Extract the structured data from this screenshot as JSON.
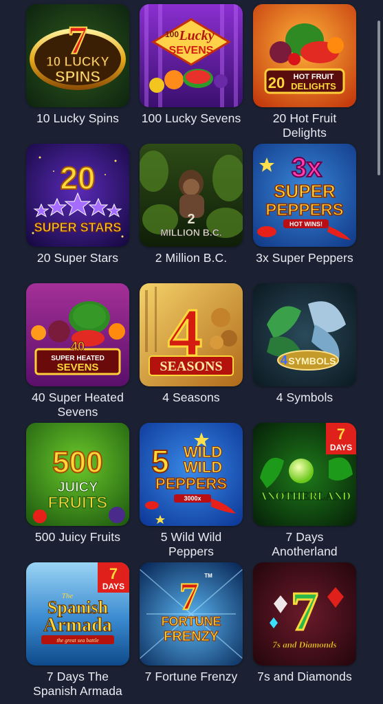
{
  "games": [
    {
      "title": "10 Lucky Spins",
      "logo": [
        "7",
        "10 LUCKY",
        "SPINS"
      ]
    },
    {
      "title": "100 Lucky Sevens",
      "logo": [
        "100",
        "Lucky",
        "SEVENS"
      ]
    },
    {
      "title": "20 Hot Fruit Delights",
      "logo": [
        "20",
        "HOT FRUIT",
        "DELIGHTS"
      ]
    },
    {
      "title": "20 Super Stars",
      "logo": [
        "20",
        "SUPER STARS"
      ]
    },
    {
      "title": "2 Million B.C.",
      "logo": [
        "2",
        "MILLION B.C."
      ]
    },
    {
      "title": "3x Super Peppers",
      "logo": [
        "3x",
        "SUPER",
        "PEPPERS",
        "HOT WINS!"
      ]
    },
    {
      "title": "40 Super Heated Sevens",
      "logo": [
        "40",
        "SUPER HEATED",
        "SEVENS"
      ]
    },
    {
      "title": "4 Seasons",
      "logo": [
        "4",
        "SEASONS"
      ]
    },
    {
      "title": "4 Symbols",
      "logo": [
        "4",
        "SYMBOLS"
      ]
    },
    {
      "title": "500 Juicy Fruits",
      "logo": [
        "500",
        "JUICY",
        "FRUITS"
      ]
    },
    {
      "title": "5 Wild Wild Peppers",
      "logo": [
        "5",
        "WILD",
        "WILD",
        "PEPPERS",
        "3000x"
      ]
    },
    {
      "title": "7 Days Anotherland",
      "logo": [
        "7",
        "DAYS",
        "ANOTHERLAND"
      ]
    },
    {
      "title": "7 Days The Spanish Armada",
      "logo": [
        "7",
        "DAYS",
        "The",
        "Spanish",
        "Armada",
        "the great sea battle"
      ]
    },
    {
      "title": "7 Fortune Frenzy",
      "logo": [
        "7",
        "FORTUNE",
        "FRENZY",
        "TM"
      ]
    },
    {
      "title": "7s and Diamonds",
      "logo": [
        "7",
        "7s and Diamonds"
      ]
    }
  ],
  "colors": {
    "background": "#1b2132",
    "title_text": "#e9ecf3",
    "scrollbar": "#8a8f9c"
  }
}
